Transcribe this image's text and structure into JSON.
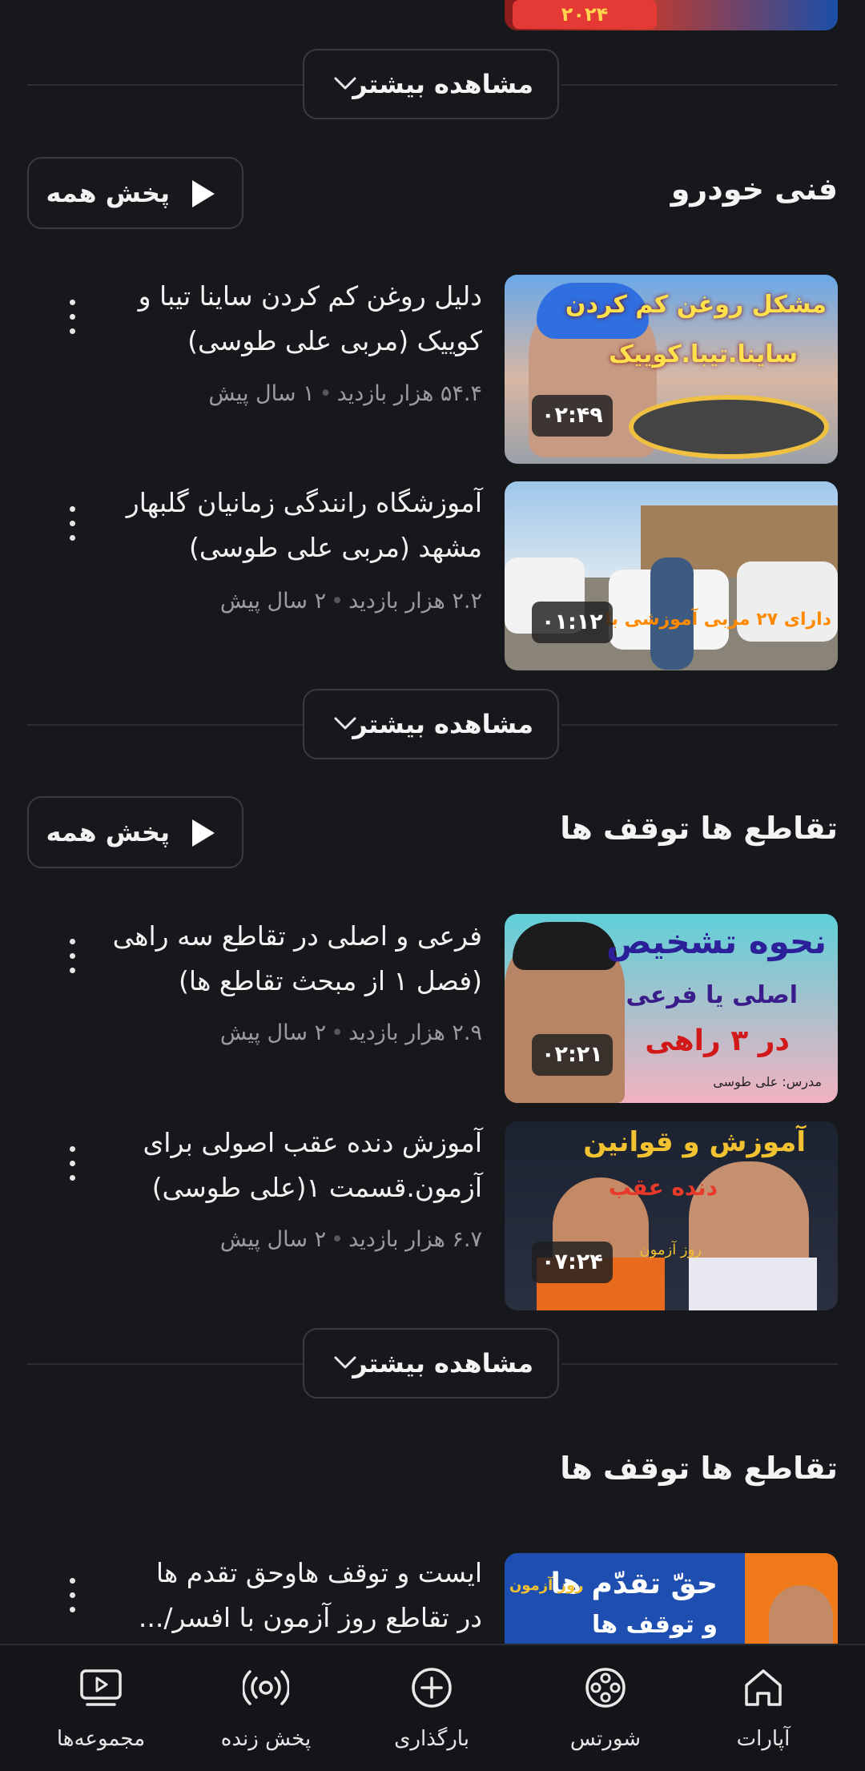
{
  "top_more_label": "مشاهده بیشتر",
  "sections": [
    {
      "title": "فنی خودرو",
      "play_all": "پخش همه",
      "more_label": "مشاهده بیشتر",
      "videos": [
        {
          "title_line1": "دلیل روغن کم کردن ساینا تیبا و",
          "title_line2": "کوییک (مربی علی طوسی)",
          "views": "۵۴.۴ هزار بازدید",
          "age": "۱ سال پیش",
          "duration": "۰۲:۴۹",
          "thumb_text1": "مشکل روغن کم کردن",
          "thumb_text2": "ساینا.تیبا.کوییک"
        },
        {
          "title_line1": "آموزشگاه رانندگی زمانیان گلبهار",
          "title_line2": "مشهد (مربی علی طوسی)",
          "views": "۲.۲ هزار بازدید",
          "age": "۲ سال پیش",
          "duration": "۰۱:۱۲",
          "thumb_text1": "دارای ۲۷ مربی آموزشی با"
        }
      ]
    },
    {
      "title": "تقاطع ها توقف ها",
      "play_all": "پخش همه",
      "more_label": "مشاهده بیشتر",
      "videos": [
        {
          "title_line1": "فرعی و اصلی در تقاطع سه راهی",
          "title_line2": "(فصل ۱ از مبحث تقاطع ها)",
          "views": "۲.۹ هزار بازدید",
          "age": "۲ سال پیش",
          "duration": "۰۲:۲۱",
          "thumb_text1": "نحوه تشخیص",
          "thumb_text2": "اصلی یا فرعی",
          "thumb_text3": "در ۳ راهی",
          "thumb_text4": "مدرس: علی طوسی"
        },
        {
          "title_line1": "آموزش دنده عقب اصولی برای",
          "title_line2": "آزمون.قسمت ۱(علی طوسی)",
          "views": "۶.۷ هزار بازدید",
          "age": "۲ سال پیش",
          "duration": "۰۷:۲۴",
          "thumb_text1": "آموزش و قوانین",
          "thumb_text2": "دنده عقب",
          "thumb_text3": "روز آزمون"
        }
      ]
    },
    {
      "title": "تقاطع ها توقف ها",
      "videos": [
        {
          "title_line1": "ایست و توقف هاوحق تقدم ها",
          "title_line2": "در تقاطع روز آزمون با افسر/...",
          "thumb_text1": "حقّ تقدّم ها",
          "thumb_text2": "روز آزمون",
          "thumb_text3": "و توقف ها"
        }
      ]
    }
  ],
  "top_thumb_text": "۲۰۲۴",
  "nav": [
    {
      "label": "آپارات",
      "icon": "home-icon"
    },
    {
      "label": "شورتس",
      "icon": "film-reel-icon"
    },
    {
      "label": "بارگذاری",
      "icon": "upload-plus-icon"
    },
    {
      "label": "پخش زنده",
      "icon": "live-broadcast-icon"
    },
    {
      "label": "مجموعه‌ها",
      "icon": "collections-icon"
    }
  ]
}
